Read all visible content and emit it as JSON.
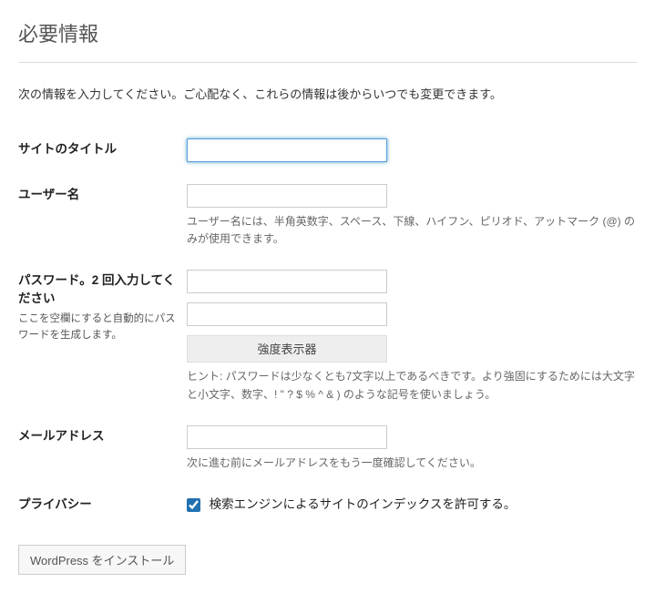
{
  "heading": "必要情報",
  "intro": "次の情報を入力してください。ご心配なく、これらの情報は後からいつでも変更できます。",
  "fields": {
    "site_title": {
      "label": "サイトのタイトル",
      "value": ""
    },
    "username": {
      "label": "ユーザー名",
      "value": "",
      "hint": "ユーザー名には、半角英数字、スペース、下線、ハイフン、ピリオド、アットマーク (@) のみが使用できます。"
    },
    "password": {
      "label": "パスワード。2 回入力してください",
      "sublabel": "ここを空欄にすると自動的にパスワードを生成します。",
      "value1": "",
      "value2": "",
      "strength_label": "強度表示器",
      "hint": "ヒント: パスワードは少なくとも7文字以上であるべきです。より強固にするためには大文字と小文字、数字、! \" ? $ % ^ & ) のような記号を使いましょう。"
    },
    "email": {
      "label": "メールアドレス",
      "value": "",
      "hint": "次に進む前にメールアドレスをもう一度確認してください。"
    },
    "privacy": {
      "label": "プライバシー",
      "checkbox_label": "検索エンジンによるサイトのインデックスを許可する。",
      "checked": true
    }
  },
  "submit": {
    "label": "WordPress をインストール"
  }
}
